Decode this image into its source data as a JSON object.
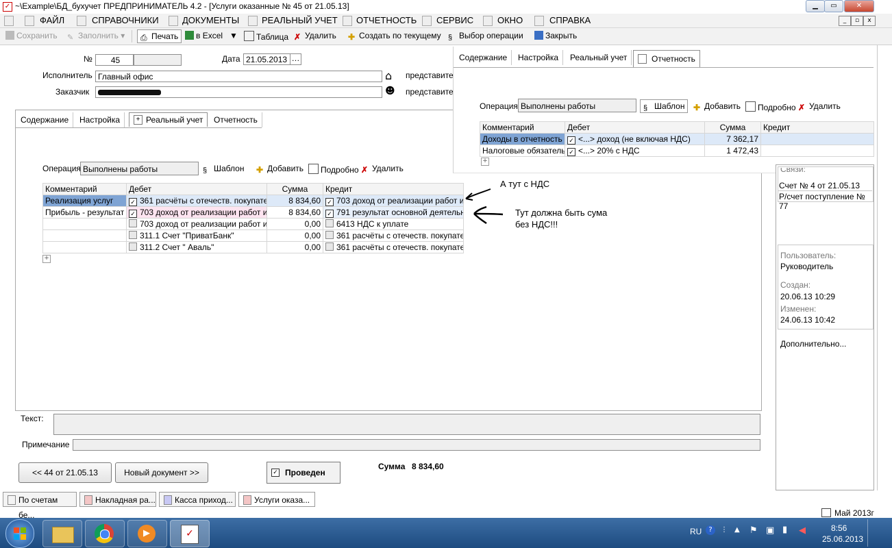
{
  "window": {
    "title": "~\\Example\\БД_бухучет  ПРЕДПРИНИМАТЕЛЬ 4.2 - [Услуги оказанные № 45 от 21.05.13]"
  },
  "menu": {
    "items": [
      "ФАЙЛ",
      "СПРАВОЧНИКИ",
      "ДОКУМЕНТЫ",
      "РЕАЛЬНЫЙ УЧЕТ",
      "ОТЧЕТНОСТЬ",
      "СЕРВИС",
      "ОКНО",
      "СПРАВКА"
    ]
  },
  "toolbar": {
    "save": "Сохранить",
    "fill": "Заполнить",
    "print": "Печать",
    "excel": "в Excel",
    "table": "Таблица",
    "delete": "Удалить",
    "create_by_current": "Создать по текущему",
    "choose_operation": "Выбор операции",
    "close": "Закрыть"
  },
  "form": {
    "number_label": "№",
    "number_value": "45",
    "date_label": "Дата",
    "date_value": "21.05.2013",
    "executor_label": "Исполнитель",
    "executor_value": "Главный офис",
    "customer_label": "Заказчик",
    "representative_label": "представител",
    "representative_label2": "представител"
  },
  "tabs": [
    "Содержание",
    "Настройка",
    "Реальный учет",
    "Отчетность"
  ],
  "operation": {
    "label": "Операция",
    "value": "Выполнены работы",
    "template": "Шаблон",
    "add": "Добавить",
    "details": "Подробно",
    "delete": "Удалить"
  },
  "grid": {
    "columns": [
      "Комментарий",
      "Дебет",
      "Сумма",
      "Кредит"
    ],
    "rows": [
      {
        "comment": "Реализация услуг",
        "debit": "361 расчёты с отечеств. покупате",
        "debit_checked": true,
        "sum": "8 834,60",
        "credit": "703 доход от реализации работ и",
        "credit_checked": true
      },
      {
        "comment": "Прибыль - результат",
        "debit": "703 доход от реализации работ и",
        "debit_checked": true,
        "sum": "8 834,60",
        "credit": "791 результат основной деятельн",
        "credit_checked": true
      },
      {
        "comment": "",
        "debit": "703 доход от реализации работ и",
        "debit_checked": false,
        "sum": "0,00",
        "credit": "6413 НДС к уплате",
        "credit_checked": false
      },
      {
        "comment": "",
        "debit": "311.1 Счет \"ПриватБанк\"",
        "debit_checked": false,
        "sum": "0,00",
        "credit": "361 расчёты с отечеств. покупате",
        "credit_checked": false
      },
      {
        "comment": "",
        "debit": "311.2 Счет \" Аваль\"",
        "debit_checked": false,
        "sum": "0,00",
        "credit": "361 расчёты с отечеств. покупате",
        "credit_checked": false
      }
    ]
  },
  "annotations": {
    "note1": "А тут с НДС",
    "note2_line1": "Тут должна быть сума",
    "note2_line2": "без НДС!!!"
  },
  "overlay": {
    "tabs": [
      "Содержание",
      "Настройка",
      "Реальный учет",
      "Отчетность"
    ],
    "operation_label": "Операция",
    "operation_value": "Выполнены работы",
    "template": "Шаблон",
    "add": "Добавить",
    "details": "Подробно",
    "delete": "Удалить",
    "columns": [
      "Комментарий",
      "Дебет",
      "Сумма",
      "Кредит"
    ],
    "rows": [
      {
        "comment": "Доходы в отчетность",
        "debit": "<...> доход (не включая НДС)",
        "sum": "7 362,17",
        "credit": ""
      },
      {
        "comment": "Налоговые обязатель",
        "debit": "<...> 20% с НДС",
        "sum": "1 472,43",
        "credit": ""
      }
    ]
  },
  "right_panel": {
    "links_partial": "Связи:",
    "link1": "Счет № 4 от 21.05.13",
    "link2": "Р/счет поступление № 77",
    "user_label": "Пользователь:",
    "user_value": "Руководитель",
    "created_label": "Создан:",
    "created_value": "20.06.13  10:29",
    "modified_label": "Изменен:",
    "modified_value": "24.06.13  10:42",
    "more": "Дополнительно..."
  },
  "bottom": {
    "text_label": "Текст:",
    "note_label": "Примечание",
    "prev_button": "<< 44 от 21.05.13",
    "new_doc_button": "Новый документ >>",
    "posted_label": "Проведен",
    "sum_label": "Сумма",
    "sum_value": "8 834,60"
  },
  "doc_tabs": [
    "По счетам бе...",
    "Накладная ра...",
    "Касса приход...",
    "Услуги оказа..."
  ],
  "status": {
    "period": "Май 2013г"
  },
  "tray": {
    "lang": "RU",
    "time": "8:56",
    "date": "25.06.2013"
  },
  "colors": {
    "accent_blue": "#c5d9f1",
    "row_pink": "#fde4f0",
    "taskbar": "#2a5a90"
  }
}
